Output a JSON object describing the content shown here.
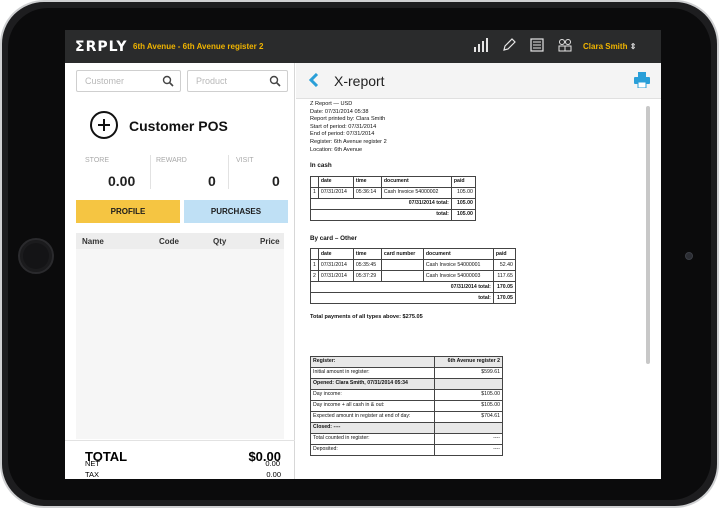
{
  "topbar": {
    "logo": "ΣRPLY",
    "location": "6th Avenue - 6th Avenue register 2",
    "user": "Clara Smith",
    "icons": [
      "signal-icon",
      "pencil-icon",
      "list-icon",
      "users-icon"
    ],
    "accent": "#f0b400"
  },
  "search": {
    "customer_placeholder": "Customer",
    "product_placeholder": "Product"
  },
  "customer": {
    "title": "Customer POS",
    "store_label": "STORE",
    "reward_label": "REWARD",
    "visit_label": "VISIT",
    "store_value": "0.00",
    "reward_value": "0",
    "visit_value": "0"
  },
  "buttons": {
    "profile": "PROFILE",
    "purchases": "PURCHASES",
    "profile_color": "#f5c542",
    "purchases_color": "#bfe0f5"
  },
  "cart": {
    "headers": [
      "Name",
      "Code",
      "Qty",
      "Price"
    ]
  },
  "totals": {
    "total_label": "TOTAL",
    "total_value": "$0.00",
    "tax_label": "TAX",
    "tax_value": "0.00",
    "net_label": "NET",
    "net_value": "0.00"
  },
  "report": {
    "title": "X-report",
    "header_lines": [
      "Z Report — USD",
      "Date: 07/31/2014 05:38",
      "Report printed by: Clara Smith",
      "Start of period: 07/31/2014",
      "End of period: 07/31/2014",
      "Register: 6th Avenue register 2",
      "Location: 6th Avenue"
    ],
    "cash": {
      "heading": "In cash",
      "headers": [
        "",
        "date",
        "time",
        "document",
        "paid"
      ],
      "rows": [
        [
          "1",
          "07/31/2014",
          "05:36:14",
          "Cash Invoice 54000002",
          "105.00"
        ]
      ],
      "subtotal_label": "07/31/2014 total:",
      "subtotal_value": "105.00",
      "total_label": "total:",
      "total_value": "105.00"
    },
    "card": {
      "heading": "By card – Other",
      "headers": [
        "",
        "date",
        "time",
        "card number",
        "document",
        "paid"
      ],
      "rows": [
        [
          "1",
          "07/31/2014",
          "05:35:45",
          "",
          "Cash Invoice 54000001",
          "52.40"
        ],
        [
          "2",
          "07/31/2014",
          "05:37:29",
          "",
          "Cash Invoice 54000003",
          "117.65"
        ]
      ],
      "subtotal_label": "07/31/2014 total:",
      "subtotal_value": "170.05",
      "total_label": "total:",
      "total_value": "170.05"
    },
    "total_payments": "Total payments of all types above: $275.05",
    "summary": [
      {
        "label": "Register:",
        "value": "6th Avenue register 2",
        "style": "gray"
      },
      {
        "label": "Initial amount in register:",
        "value": "$599.61"
      },
      {
        "label": "Opened: Clara Smith, 07/31/2014 05:34",
        "value": "",
        "style": "gray"
      },
      {
        "label": "Day income:",
        "value": "$105.00"
      },
      {
        "label": "Day income + all cash in & out:",
        "value": "$105.00"
      },
      {
        "label": "Expected amount in register at end of day:",
        "value": "$704.61"
      },
      {
        "label": "Closed: ----",
        "value": "",
        "style": "gray"
      },
      {
        "label": "Total counted in register:",
        "value": "----"
      },
      {
        "label": "Deposited:",
        "value": "----"
      }
    ]
  }
}
